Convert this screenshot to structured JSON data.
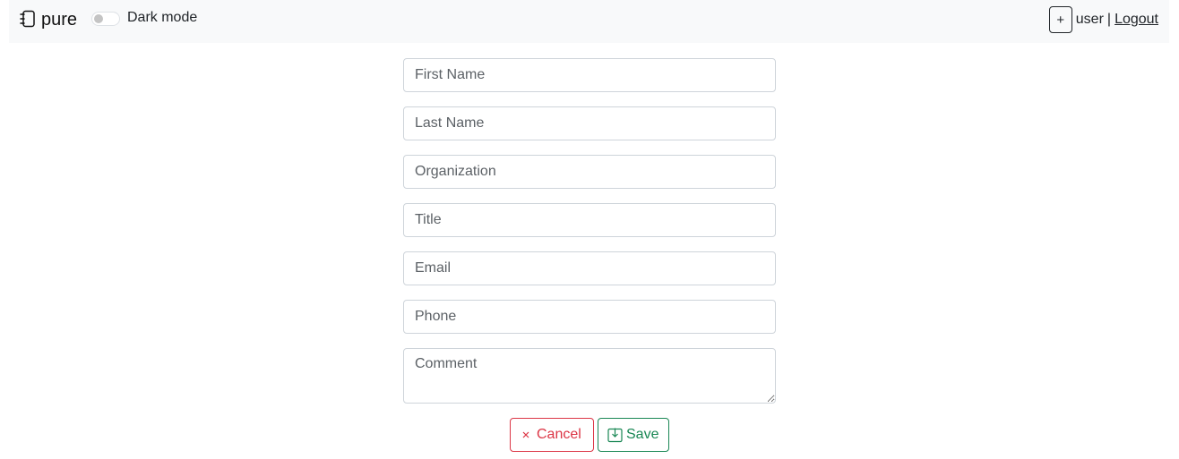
{
  "navbar": {
    "brand": "pure",
    "dark_mode_label": "Dark mode",
    "add_button_label": "+",
    "user": "user",
    "separator": "|",
    "logout_label": "Logout"
  },
  "form": {
    "fields": {
      "first_name": "First Name",
      "last_name": "Last Name",
      "organization": "Organization",
      "title": "Title",
      "email": "Email",
      "phone": "Phone",
      "comment": "Comment"
    },
    "cancel_label": "Cancel",
    "save_label": "Save"
  },
  "colors": {
    "navbar_bg": "#f8f9fa",
    "cancel": "#dc3545",
    "save": "#198754",
    "border": "#ced4da"
  },
  "icons": {
    "brand": "journal-icon",
    "cancel": "close-icon",
    "save": "save-icon"
  }
}
